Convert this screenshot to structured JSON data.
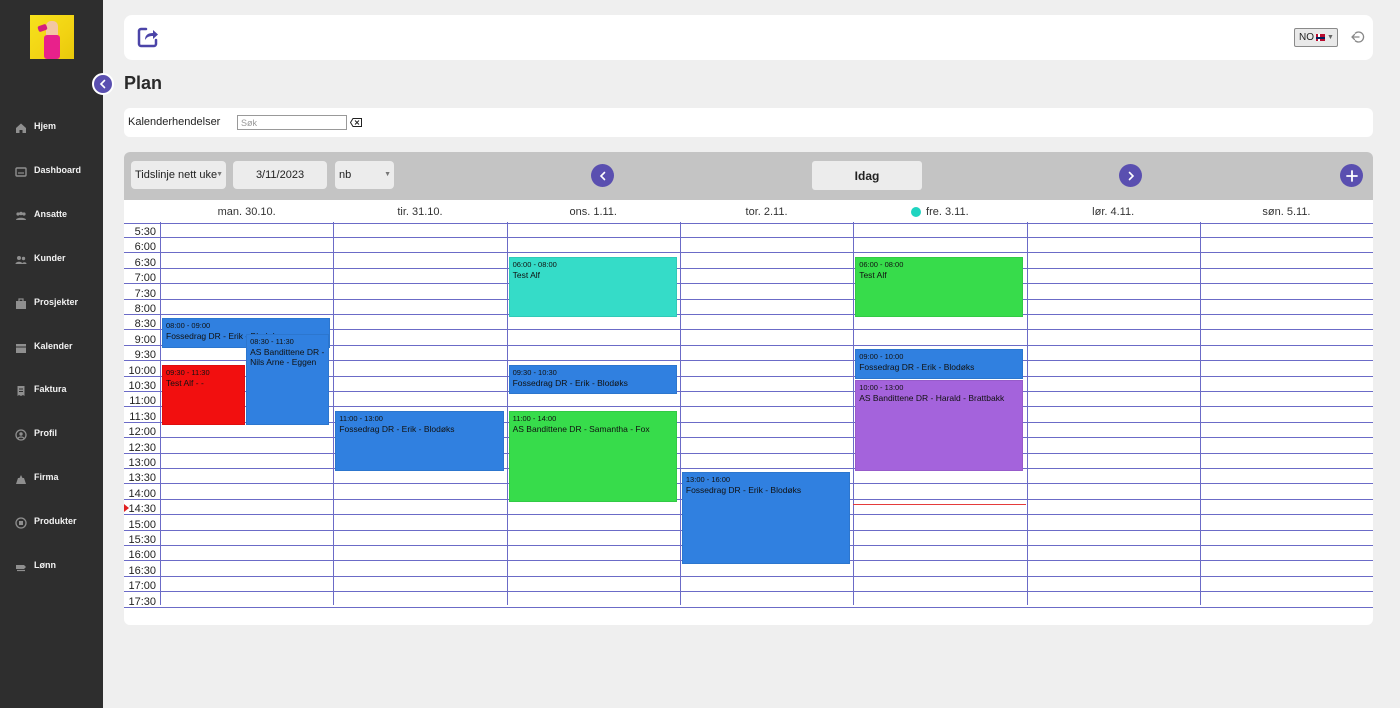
{
  "nav": [
    {
      "id": "home",
      "label": "Hjem",
      "icon": "home-icon"
    },
    {
      "id": "dashboard",
      "label": "Dashboard",
      "icon": "dashboard-icon"
    },
    {
      "id": "employees",
      "label": "Ansatte",
      "icon": "employees-icon"
    },
    {
      "id": "customers",
      "label": "Kunder",
      "icon": "customers-icon"
    },
    {
      "id": "projects",
      "label": "Prosjekter",
      "icon": "projects-icon"
    },
    {
      "id": "calendar",
      "label": "Kalender",
      "icon": "calendar-icon"
    },
    {
      "id": "invoice",
      "label": "Faktura",
      "icon": "invoice-icon"
    },
    {
      "id": "profile",
      "label": "Profil",
      "icon": "profile-icon"
    },
    {
      "id": "company",
      "label": "Firma",
      "icon": "company-icon"
    },
    {
      "id": "products",
      "label": "Produkter",
      "icon": "products-icon"
    },
    {
      "id": "salary",
      "label": "Lønn",
      "icon": "salary-icon"
    }
  ],
  "header": {
    "language": "NO"
  },
  "page": {
    "title": "Plan"
  },
  "search": {
    "label": "Kalenderhendelser",
    "placeholder": "Søk",
    "value": ""
  },
  "toolbar": {
    "view": "Tidslinje nett uke",
    "date": "3/11/2023",
    "locale": "nb",
    "today_label": "Idag"
  },
  "calendar": {
    "days": [
      "man. 30.10.",
      "tir. 31.10.",
      "ons. 1.11.",
      "tor. 2.11.",
      "fre. 3.11.",
      "lør. 4.11.",
      "søn. 5.11."
    ],
    "today_index": 4,
    "times": [
      "5:30",
      "6:00",
      "6:30",
      "7:00",
      "7:30",
      "8:00",
      "8:30",
      "9:00",
      "9:30",
      "10:00",
      "10:30",
      "11:00",
      "11:30",
      "12:00",
      "12:30",
      "13:00",
      "13:30",
      "14:00",
      "14:30",
      "15:00",
      "15:30",
      "16:00",
      "16:30",
      "17:00",
      "17:30"
    ],
    "now": {
      "day": 4,
      "time": "14:00"
    },
    "events": [
      {
        "day": 0,
        "start": "08:00",
        "end": "09:00",
        "time": "08:00 - 09:00",
        "title": "Fossedrag DR - Erik - Blodøks",
        "color": "#3080e0",
        "lane": 0,
        "lanes": 1
      },
      {
        "day": 0,
        "start": "08:30",
        "end": "11:30",
        "time": "08:30 - 11:30",
        "title": "AS Bandittene DR - Nils Arne - Eggen",
        "color": "#3080e0",
        "lane": 1,
        "lanes": 2
      },
      {
        "day": 0,
        "start": "09:30",
        "end": "11:30",
        "time": "09:30 - 11:30",
        "title": "Test Alf - -",
        "color": "#f20f0f",
        "lane": 0,
        "lanes": 2
      },
      {
        "day": 1,
        "start": "11:00",
        "end": "13:00",
        "time": "11:00 - 13:00",
        "title": "Fossedrag DR - Erik - Blodøks",
        "color": "#3080e0",
        "lane": 0,
        "lanes": 1
      },
      {
        "day": 2,
        "start": "06:00",
        "end": "08:00",
        "time": "06:00 - 08:00",
        "title": "Test Alf",
        "color": "#35dcc8",
        "lane": 0,
        "lanes": 1
      },
      {
        "day": 2,
        "start": "09:30",
        "end": "10:30",
        "time": "09:30 - 10:30",
        "title": "Fossedrag DR - Erik - Blodøks",
        "color": "#3080e0",
        "lane": 0,
        "lanes": 1
      },
      {
        "day": 2,
        "start": "11:00",
        "end": "14:00",
        "time": "11:00 - 14:00",
        "title": "AS Bandittene DR - Samantha - Fox",
        "color": "#37dc4b",
        "lane": 0,
        "lanes": 1
      },
      {
        "day": 3,
        "start": "13:00",
        "end": "16:00",
        "time": "13:00 - 16:00",
        "title": "Fossedrag DR - Erik - Blodøks",
        "color": "#3080e0",
        "lane": 0,
        "lanes": 1
      },
      {
        "day": 4,
        "start": "06:00",
        "end": "08:00",
        "time": "06:00 - 08:00",
        "title": "Test Alf",
        "color": "#37dc4b",
        "lane": 0,
        "lanes": 1
      },
      {
        "day": 4,
        "start": "09:00",
        "end": "10:00",
        "time": "09:00 - 10:00",
        "title": "Fossedrag DR - Erik - Blodøks",
        "color": "#3080e0",
        "lane": 0,
        "lanes": 1
      },
      {
        "day": 4,
        "start": "10:00",
        "end": "13:00",
        "time": "10:00 - 13:00",
        "title": "AS Bandittene DR - Harald - Brattbakk",
        "color": "#a463dc",
        "lane": 0,
        "lanes": 1
      }
    ]
  },
  "colors": {
    "accent": "#5a4fb0",
    "sidebar": "#2e2e2e",
    "grid": "#6b6bc7"
  }
}
